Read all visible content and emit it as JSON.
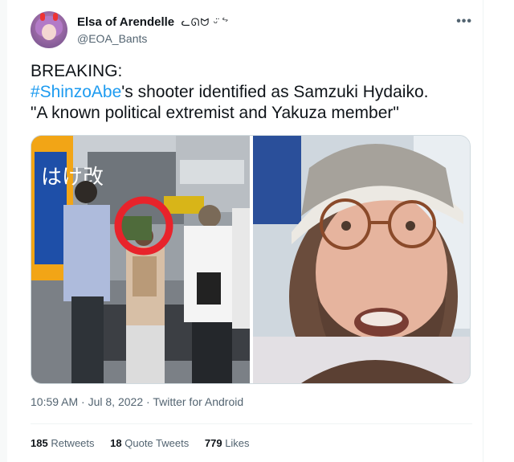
{
  "user": {
    "display_name": "Elsa of Arendelle",
    "name_emoji": "ᓚᘏᗢ ᵕ̈ ᖦ",
    "handle": "@EOA_Bants"
  },
  "more_menu": "•••",
  "tweet": {
    "line1": "BREAKING:",
    "hashtag": "#ShinzoAbe",
    "line2_rest": "'s shooter identified as Samzuki Hydaiko.",
    "line3": "\"A known political extremist and Yakuza member\""
  },
  "meta": {
    "time": "10:59 AM",
    "dot1": " · ",
    "date": "Jul 8, 2022",
    "dot2": " · ",
    "client": "Twitter for Android"
  },
  "stats": {
    "retweets_count": "185",
    "retweets_label": "Retweets",
    "quotes_count": "18",
    "quotes_label": "Quote Tweets",
    "likes_count": "779",
    "likes_label": "Likes"
  },
  "media": {
    "left_sign_text": "はけ改",
    "colors": {
      "highlight_circle": "#e8232b",
      "sign_orange": "#f2a516",
      "sign_blue": "#1e4fa8",
      "beanie": "#ece9e3",
      "beard": "#5b4033"
    }
  },
  "colors": {
    "link": "#1d9bf0",
    "text": "#0f1419",
    "secondary": "#536471"
  }
}
